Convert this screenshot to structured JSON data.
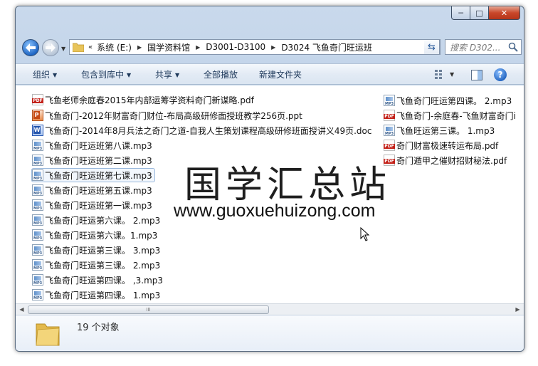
{
  "window": {
    "caption_buttons": {
      "minimize": "─",
      "maximize": "□",
      "close": "✕"
    }
  },
  "address": {
    "chevron": "«",
    "crumbs": [
      "系统 (E:)",
      "国学资料馆",
      "D3001-D3100",
      "D3024 飞鱼奇门旺运班"
    ],
    "search_placeholder": "搜索 D302...",
    "refresh_glyph": "⇆"
  },
  "toolbar": {
    "organize": "组织",
    "include_in_library": "包含到库中",
    "share": "共享",
    "play_all": "全部播放",
    "new_folder": "新建文件夹",
    "help": "?"
  },
  "files": [
    {
      "name": "飞鱼老师余庭春2015年内部运筹学资料奇门新谋略.pdf",
      "type": "pdf"
    },
    {
      "name": "飞鱼奇门-2012年财富奇门财位-布局高级研修面授班教学256页.ppt",
      "type": "ppt"
    },
    {
      "name": "飞鱼奇门-2014年8月兵法之奇门之道-自我人生策划课程高级研修班面授讲义49页.doc",
      "type": "doc"
    },
    {
      "name": "飞鱼奇门旺运班第八课.mp3",
      "type": "mp3"
    },
    {
      "name": "飞鱼奇门旺运班第二课.mp3",
      "type": "mp3"
    },
    {
      "name": "飞鱼奇门旺运班第七课.mp3",
      "type": "mp3",
      "selected": true
    },
    {
      "name": "飞鱼奇门旺运班第五课.mp3",
      "type": "mp3"
    },
    {
      "name": "飞鱼奇门旺运班第一课.mp3",
      "type": "mp3"
    },
    {
      "name": "飞鱼奇门旺运第六课。  2.mp3",
      "type": "mp3"
    },
    {
      "name": "飞鱼奇门旺运第六课。1.mp3",
      "type": "mp3"
    },
    {
      "name": "飞鱼奇门旺运第三课。    3.mp3",
      "type": "mp3"
    },
    {
      "name": "飞鱼奇门旺运第三课。   2.mp3",
      "type": "mp3"
    },
    {
      "name": "飞鱼奇门旺运第四课。  ,3.mp3",
      "type": "mp3"
    },
    {
      "name": "飞鱼奇门旺运第四课。 1.mp3",
      "type": "mp3"
    },
    {
      "name": "飞鱼奇门旺运第四课。  2.mp3",
      "type": "mp3"
    },
    {
      "name": "飞鱼奇门-余庭春-飞鱼财富奇门i",
      "type": "pdf"
    },
    {
      "name": "飞鱼旺运第三课。  1.mp3",
      "type": "mp3"
    },
    {
      "name": "奇门财富极速转运布局.pdf",
      "type": "pdf"
    },
    {
      "name": "奇门遁甲之催财招财秘法.pdf",
      "type": "pdf"
    }
  ],
  "watermark": {
    "title": "国学汇总站",
    "url": "www.guoxuehuizong.com"
  },
  "status": {
    "item_count": "19 个对象"
  },
  "scrollbar": {
    "grip": "III"
  }
}
